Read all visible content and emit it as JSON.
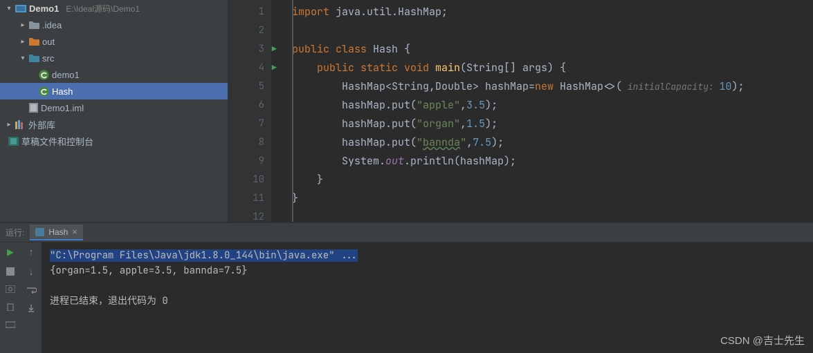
{
  "project": {
    "name": "Demo1",
    "path": "E:\\Ideal源码\\Demo1"
  },
  "tree": {
    "idea": ".idea",
    "out": "out",
    "src": "src",
    "demo1": "demo1",
    "hash": "Hash",
    "iml": "Demo1.iml",
    "ext_lib": "外部库",
    "scratch": "草稿文件和控制台"
  },
  "gutter": [
    "1",
    "2",
    "3",
    "4",
    "5",
    "6",
    "7",
    "8",
    "9",
    "10",
    "11",
    "12"
  ],
  "code": {
    "l1_import": "import",
    "l1_pkg": " java.util.HashMap;",
    "l3_public": "public class ",
    "l3_cls": "Hash",
    "l3_b": " {",
    "l4_ps": "public static void ",
    "l4_main": "main",
    "l4_sig": "(String[] args) {",
    "l5_a": "HashMap<String,Double> hashMap=",
    "l5_new": "new ",
    "l5_b": "HashMap<>(",
    "l5_hint": " initialCapacity: ",
    "l5_num": "10",
    "l5_c": ");",
    "l6": "hashMap.put(",
    "l6s": "\"apple\"",
    "l6n": "3.5",
    "l6e": ");",
    "l7": "hashMap.put(",
    "l7s": "\"organ\"",
    "l7n": "1.5",
    "l7e": ");",
    "l8": "hashMap.put(",
    "l8s": "\"bannda\"",
    "l8n": "7.5",
    "l8e": ");",
    "l9a": "System.",
    "l9out": "out",
    "l9b": ".println(hashMap);",
    "l10": "}",
    "l11": "}"
  },
  "run": {
    "label": "运行:",
    "tab": "Hash"
  },
  "console": {
    "cmd": "\"C:\\Program Files\\Java\\jdk1.8.0_144\\bin\\java.exe\" ...",
    "out": "{organ=1.5, apple=3.5, bannda=7.5}",
    "exit": "进程已结束，退出代码为 0"
  },
  "watermark": "CSDN @吉士先生"
}
